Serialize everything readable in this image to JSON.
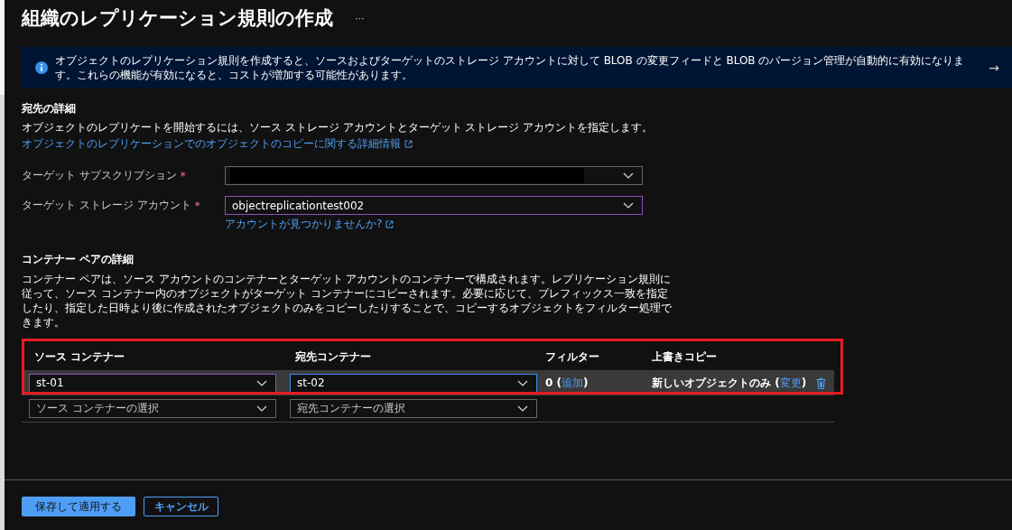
{
  "title": "組織のレプリケーション規則の作成",
  "more_button": "···",
  "info_banner": {
    "text": "オブジェクトのレプリケーション規則を作成すると、ソースおよびターゲットのストレージ アカウントに対して BLOB の変更フィードと BLOB のバージョン管理が自動的に有効になります。これらの機能が有効になると、コストが増加する可能性があります。",
    "arrow": "→"
  },
  "destination": {
    "heading": "宛先の詳細",
    "description": "オブジェクトのレプリケートを開始するには、ソース ストレージ アカウントとターゲット ストレージ アカウントを指定します。",
    "link": "オブジェクトのレプリケーションでのオブジェクトのコピーに関する詳細情報",
    "fields": [
      {
        "label": "ターゲット サブスクリプション",
        "required_mark": "*",
        "kind": "redacted",
        "hovered": false
      },
      {
        "label": "ターゲット ストレージ アカウント",
        "required_mark": "*",
        "kind": "select",
        "value": "objectreplicationtest002",
        "hovered": true,
        "help_link": "アカウントが見つかりませんか?"
      }
    ]
  },
  "container_pairs": {
    "heading": "コンテナー ペアの詳細",
    "description": "コンテナー ペアは、ソース アカウントのコンテナーとターゲット アカウントのコンテナーで構成されます。レプリケーション規則に従って、ソース コンテナー内のオブジェクトがターゲット コンテナーにコピーされます。必要に応じて、プレフィックス一致を指定したり、指定した日時より後に作成されたオブジェクトのみをコピーしたりすることで、コピーするオブジェクトをフィルター処理できます。",
    "columns": [
      "ソース コンテナー",
      "宛先コンテナー",
      "フィルター",
      "上書きコピー"
    ],
    "rows": [
      {
        "selected": true,
        "source": {
          "value": "st-01",
          "hovered": true,
          "focused": false
        },
        "destination": {
          "value": "st-02",
          "hovered": false,
          "focused": true
        },
        "filter": {
          "prefix": "0 (",
          "link": "追加",
          "suffix": ")"
        },
        "overwrite": {
          "prefix": "新しいオブジェクトのみ (",
          "link": "変更",
          "suffix": ")"
        }
      },
      {
        "selected": false,
        "source": {
          "placeholder": "ソース コンテナーの選択",
          "hovered": false,
          "focused": false
        },
        "destination": {
          "placeholder": "宛先コンテナーの選択",
          "hovered": false,
          "focused": false
        }
      }
    ],
    "highlighted": true
  },
  "buttons": [
    {
      "label": "保存して適用する",
      "kind": "primary"
    },
    {
      "label": "キャンセル",
      "kind": "secondary"
    }
  ]
}
